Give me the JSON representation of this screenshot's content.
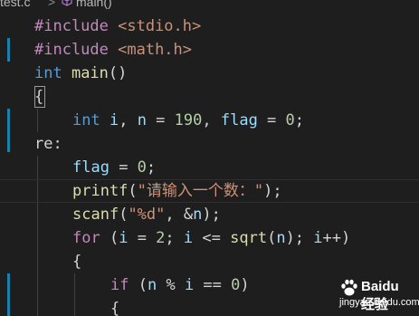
{
  "breadcrumb": {
    "file": "test.c",
    "separator": ">",
    "symbol": "main()",
    "symbol_icon": "cube-icon"
  },
  "code_lines": [
    {
      "tokens": [
        [
          "kw-pre",
          "#include "
        ],
        [
          "str",
          "<stdio.h>"
        ]
      ]
    },
    {
      "tokens": [
        [
          "kw-pre",
          "#include "
        ],
        [
          "str",
          "<math.h>"
        ]
      ]
    },
    {
      "tokens": [
        [
          "kw-type",
          "int "
        ],
        [
          "fn",
          "main"
        ],
        [
          "plain",
          "()"
        ]
      ]
    },
    {
      "tokens": [
        [
          "plain",
          "{"
        ]
      ]
    },
    {
      "tokens": [
        [
          "kw-type",
          "int "
        ],
        [
          "var",
          "i"
        ],
        [
          "plain",
          ", "
        ],
        [
          "var",
          "n"
        ],
        [
          "plain",
          " = "
        ],
        [
          "num",
          "190"
        ],
        [
          "plain",
          ", "
        ],
        [
          "var",
          "flag"
        ],
        [
          "plain",
          " = "
        ],
        [
          "num",
          "0"
        ],
        [
          "plain",
          ";"
        ]
      ]
    },
    {
      "tokens": [
        [
          "plain",
          "re:"
        ]
      ]
    },
    {
      "tokens": [
        [
          "var",
          "flag"
        ],
        [
          "plain",
          " = "
        ],
        [
          "num",
          "0"
        ],
        [
          "plain",
          ";"
        ]
      ]
    },
    {
      "tokens": [
        [
          "fn",
          "printf"
        ],
        [
          "plain",
          "("
        ],
        [
          "str",
          "\"请输入一个数：\""
        ],
        [
          "plain",
          ");"
        ]
      ]
    },
    {
      "tokens": [
        [
          "fn",
          "scanf"
        ],
        [
          "plain",
          "("
        ],
        [
          "str",
          "\"%d\""
        ],
        [
          "plain",
          ", &"
        ],
        [
          "var",
          "n"
        ],
        [
          "plain",
          ");"
        ]
      ]
    },
    {
      "tokens": [
        [
          "kw-ctl",
          "for"
        ],
        [
          "plain",
          " ("
        ],
        [
          "var",
          "i"
        ],
        [
          "plain",
          " = "
        ],
        [
          "num",
          "2"
        ],
        [
          "plain",
          "; "
        ],
        [
          "var",
          "i"
        ],
        [
          "plain",
          " <= "
        ],
        [
          "fn",
          "sqrt"
        ],
        [
          "plain",
          "("
        ],
        [
          "var",
          "n"
        ],
        [
          "plain",
          "); "
        ],
        [
          "var",
          "i"
        ],
        [
          "plain",
          "++)"
        ]
      ]
    },
    {
      "tokens": [
        [
          "plain",
          "{"
        ]
      ]
    },
    {
      "tokens": [
        [
          "kw-ctl",
          "if"
        ],
        [
          "plain",
          " ("
        ],
        [
          "var",
          "n"
        ],
        [
          "plain",
          " % "
        ],
        [
          "var",
          "i"
        ],
        [
          "plain",
          " == "
        ],
        [
          "num",
          "0"
        ],
        [
          "plain",
          ")"
        ]
      ]
    },
    {
      "tokens": [
        [
          "plain",
          "{"
        ]
      ]
    }
  ],
  "colors": {
    "background": "#1e1e1e",
    "gutter_change": "#1b81a8",
    "keyword": "#c586c0",
    "type": "#569cd6",
    "string": "#ce9178",
    "number": "#b5cea8",
    "function": "#dcdcaa",
    "variable": "#9cdcfe"
  },
  "watermark": {
    "brand": "Baidu 经验",
    "url": "jingyan.baidu.com",
    "icon": "baidu-paw-icon"
  }
}
